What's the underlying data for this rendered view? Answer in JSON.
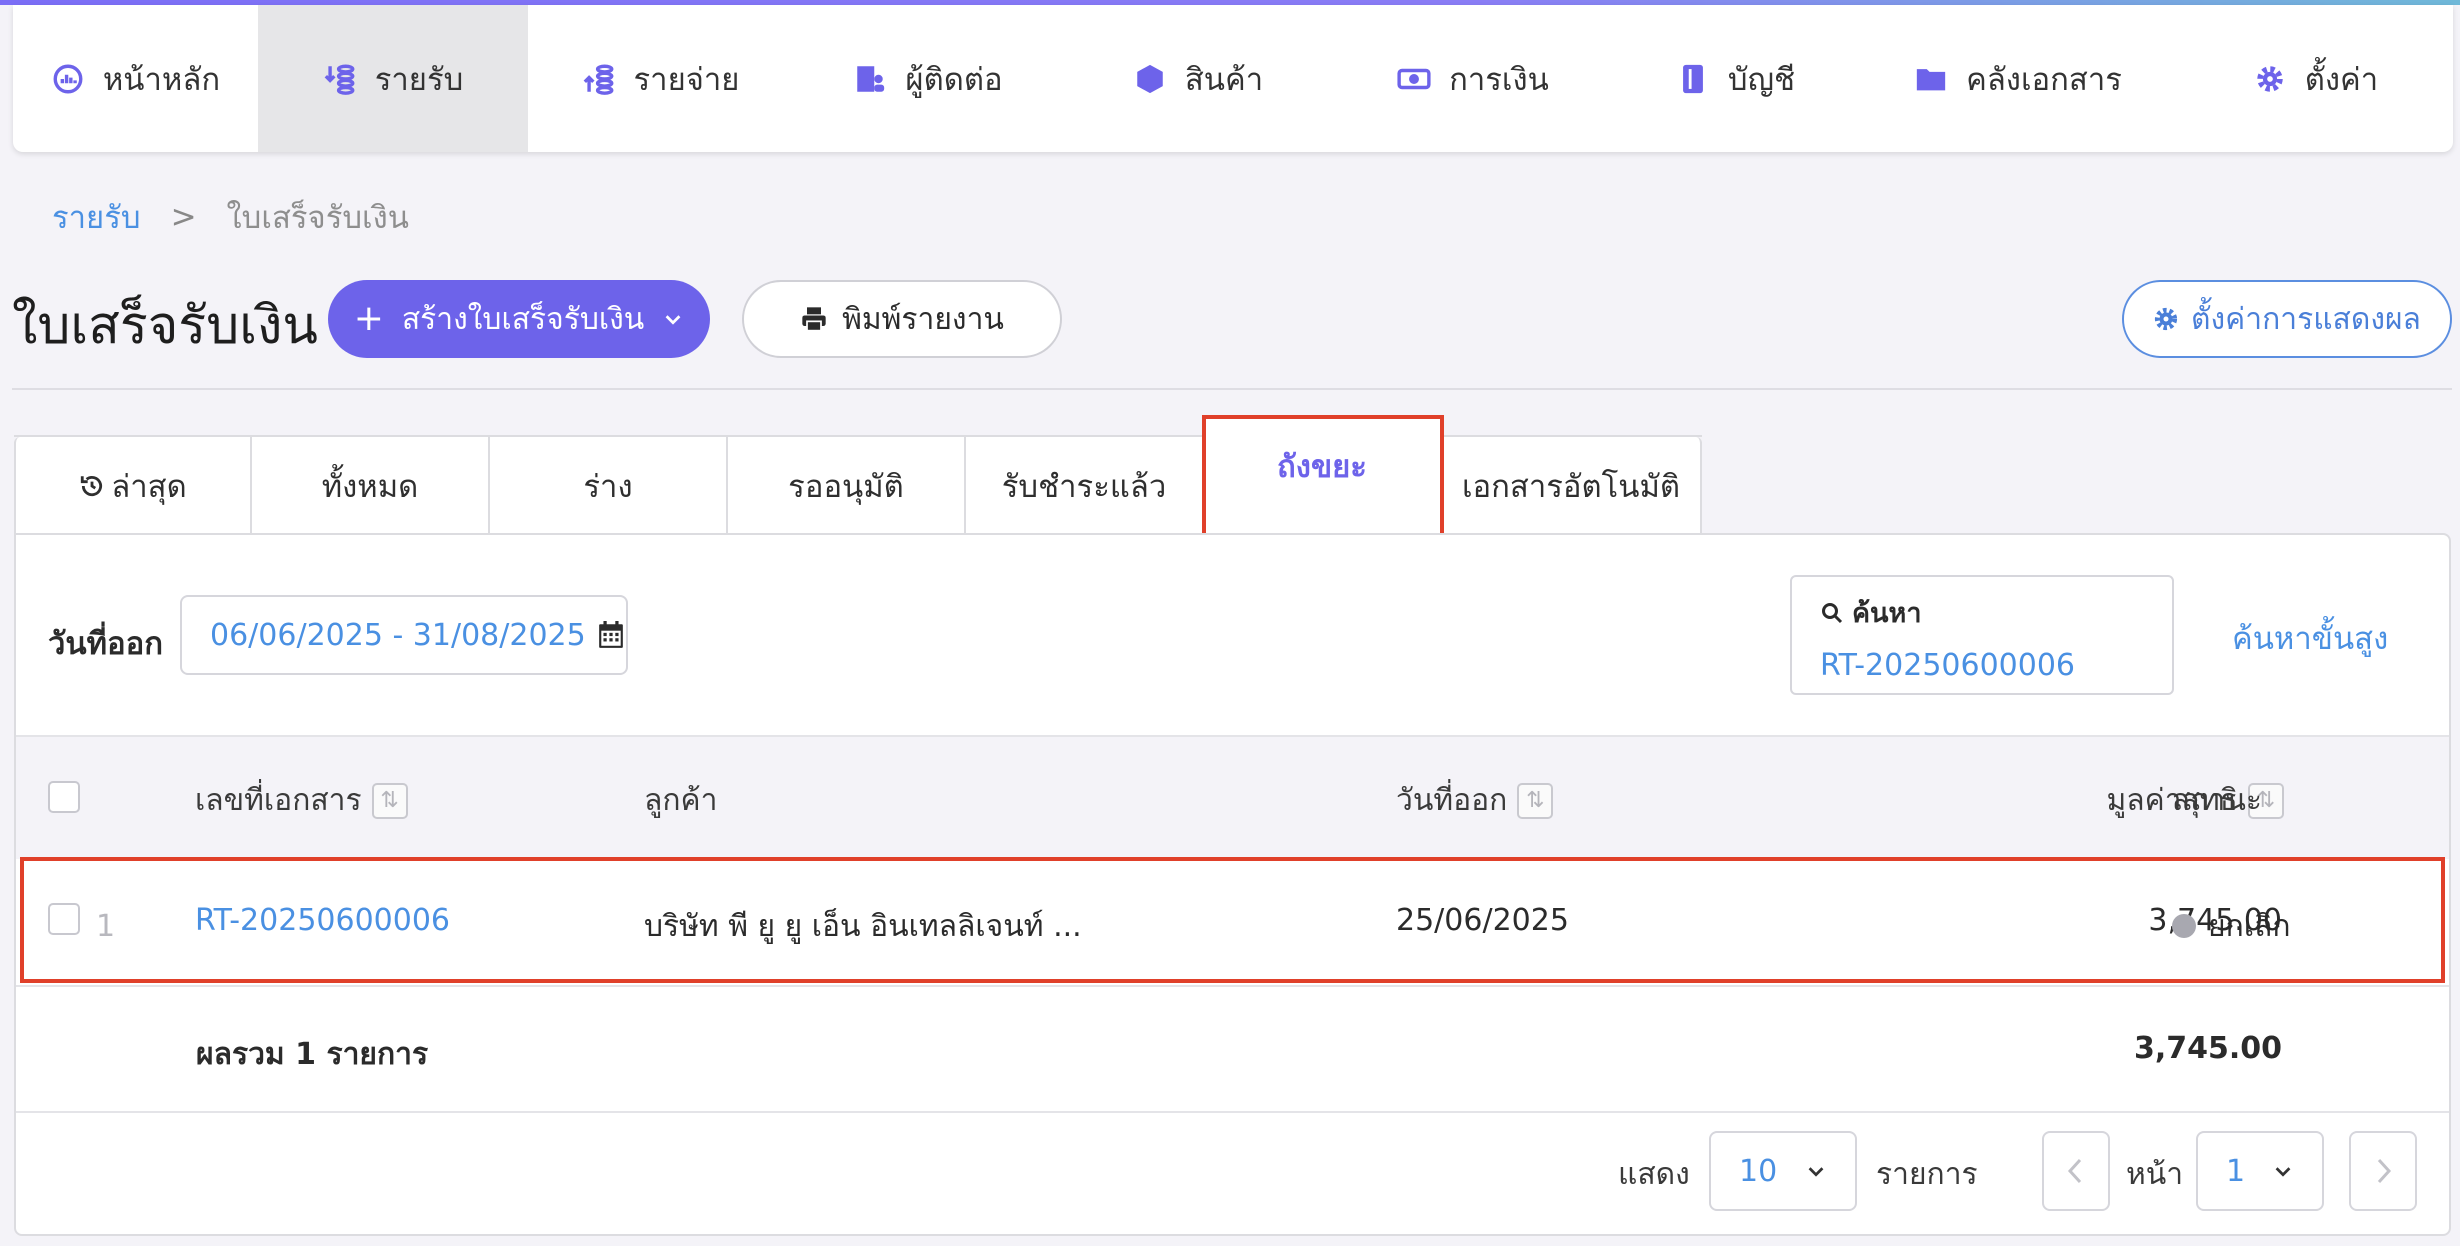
{
  "nav": {
    "items": [
      {
        "label": "หน้าหลัก",
        "icon": "dashboard-icon"
      },
      {
        "label": "รายรับ",
        "icon": "income-icon"
      },
      {
        "label": "รายจ่าย",
        "icon": "expense-icon"
      },
      {
        "label": "ผู้ติดต่อ",
        "icon": "contacts-icon"
      },
      {
        "label": "สินค้า",
        "icon": "box-icon"
      },
      {
        "label": "การเงิน",
        "icon": "money-icon"
      },
      {
        "label": "บัญชี",
        "icon": "ledger-icon"
      },
      {
        "label": "คลังเอกสาร",
        "icon": "folder-icon"
      },
      {
        "label": "ตั้งค่า",
        "icon": "gear-icon"
      }
    ],
    "active_index": 1
  },
  "breadcrumb": {
    "parent": "รายรับ",
    "separator": ">",
    "current": "ใบเสร็จรับเงิน"
  },
  "header": {
    "title": "ใบเสร็จรับเงิน",
    "create_button": "สร้างใบเสร็จรับเงิน",
    "print_button": "พิมพ์รายงาน",
    "display_settings_button": "ตั้งค่าการแสดงผล"
  },
  "tabs": [
    {
      "label": "ล่าสุด"
    },
    {
      "label": "ทั้งหมด"
    },
    {
      "label": "ร่าง"
    },
    {
      "label": "รออนุมัติ"
    },
    {
      "label": "รับชำระแล้ว"
    },
    {
      "label": "ถังขยะ"
    },
    {
      "label": "เอกสารอัตโนมัติ"
    }
  ],
  "active_tab": "ถังขยะ",
  "filter": {
    "date_label": "วันที่ออก",
    "date_range": "06/06/2025 - 31/08/2025",
    "search_label": "ค้นหา",
    "search_value": "RT-20250600006",
    "advanced_search": "ค้นหาขั้นสูง"
  },
  "table": {
    "columns": {
      "doc_no": "เลขที่เอกสาร",
      "customer": "ลูกค้า",
      "issue_date": "วันที่ออก",
      "net_value": "มูลค่าสุทธิ",
      "status": "สถานะ"
    },
    "rows": [
      {
        "index": "1",
        "doc_no": "RT-20250600006",
        "customer": "บริษัท พี ยู ยู เอ็น อินเทลลิเจนท์ ...",
        "issue_date": "25/06/2025",
        "net_value": "3,745.00",
        "status": "ยกเลิก"
      }
    ],
    "total_label": "ผลรวม 1 รายการ",
    "total_value": "3,745.00"
  },
  "pagination": {
    "show_label": "แสดง",
    "page_size": "10",
    "items_label": "รายการ",
    "page_label": "หน้า",
    "page": "1"
  },
  "colors": {
    "accent": "#6d63ea",
    "link": "#4a90e2",
    "highlight": "#e0402a"
  }
}
